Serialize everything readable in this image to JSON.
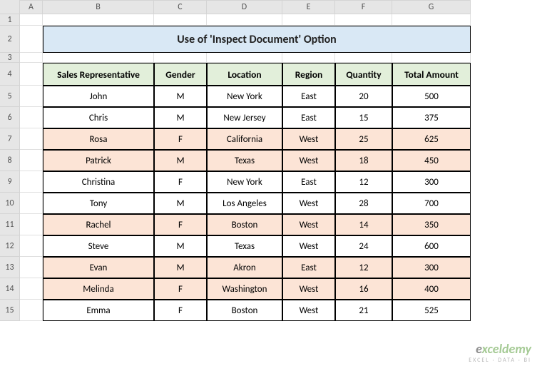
{
  "columns": [
    "A",
    "B",
    "C",
    "D",
    "E",
    "F",
    "G"
  ],
  "rows": [
    "1",
    "2",
    "3",
    "4",
    "5",
    "6",
    "7",
    "8",
    "9",
    "10",
    "11",
    "12",
    "13",
    "14",
    "15"
  ],
  "title": "Use of 'Inspect Document' Option",
  "headers": [
    "Sales Representative",
    "Gender",
    "Location",
    "Region",
    "Quantity",
    "Total Amount"
  ],
  "chart_data": {
    "type": "table",
    "columns": [
      "Sales Representative",
      "Gender",
      "Location",
      "Region",
      "Quantity",
      "Total Amount"
    ],
    "rows": [
      {
        "rep": "John",
        "gender": "M",
        "location": "New York",
        "region": "East",
        "quantity": 20,
        "total": 500,
        "highlight": false
      },
      {
        "rep": "Chris",
        "gender": "M",
        "location": "New Jersey",
        "region": "East",
        "quantity": 15,
        "total": 375,
        "highlight": false
      },
      {
        "rep": "Rosa",
        "gender": "F",
        "location": "California",
        "region": "West",
        "quantity": 25,
        "total": 625,
        "highlight": true
      },
      {
        "rep": "Patrick",
        "gender": "M",
        "location": "Texas",
        "region": "West",
        "quantity": 18,
        "total": 450,
        "highlight": true
      },
      {
        "rep": "Christina",
        "gender": "F",
        "location": "New York",
        "region": "East",
        "quantity": 12,
        "total": 300,
        "highlight": false
      },
      {
        "rep": "Tony",
        "gender": "M",
        "location": "Los Angeles",
        "region": "West",
        "quantity": 28,
        "total": 700,
        "highlight": false
      },
      {
        "rep": "Rachel",
        "gender": "F",
        "location": "Boston",
        "region": "West",
        "quantity": 14,
        "total": 350,
        "highlight": true
      },
      {
        "rep": "Steve",
        "gender": "M",
        "location": "Texas",
        "region": "West",
        "quantity": 24,
        "total": 600,
        "highlight": false
      },
      {
        "rep": "Evan",
        "gender": "M",
        "location": "Akron",
        "region": "East",
        "quantity": 12,
        "total": 300,
        "highlight": true
      },
      {
        "rep": "Melinda",
        "gender": "F",
        "location": "Washington",
        "region": "West",
        "quantity": 16,
        "total": 400,
        "highlight": true
      },
      {
        "rep": "Emma",
        "gender": "F",
        "location": "Boston",
        "region": "West",
        "quantity": 21,
        "total": 525,
        "highlight": false
      }
    ]
  },
  "watermark": {
    "brand_prefix": "e",
    "brand_suffix": "xceldemy",
    "tagline": "EXCEL · DATA · BI"
  }
}
